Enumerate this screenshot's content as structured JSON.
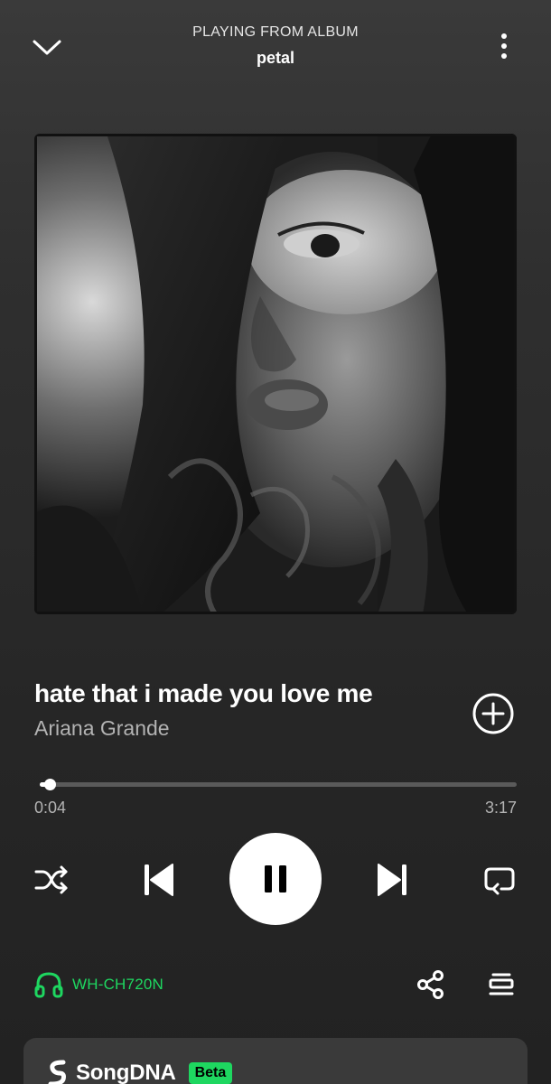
{
  "header": {
    "context_label": "PLAYING FROM ALBUM",
    "context_name": "petal",
    "collapse_icon": "chevron-down-icon",
    "more_icon": "more-vertical-icon"
  },
  "track": {
    "title": "hate that i made you love me",
    "artist": "Ariana Grande",
    "add_icon": "add-circle-icon"
  },
  "playback": {
    "elapsed": "0:04",
    "duration": "3:17",
    "progress_fraction": 0.02,
    "state": "playing"
  },
  "controls": {
    "shuffle_icon": "shuffle-icon",
    "previous_icon": "skip-previous-icon",
    "pause_icon": "pause-icon",
    "next_icon": "skip-next-icon",
    "repeat_icon": "repeat-icon"
  },
  "device": {
    "name": "WH-CH720N",
    "icon": "headphones-icon"
  },
  "actions": {
    "share_icon": "share-icon",
    "queue_icon": "queue-icon"
  },
  "card": {
    "name": "SongDNA",
    "badge": "Beta",
    "logo_icon": "songdna-logo-icon"
  },
  "colors": {
    "accent": "#1ed760",
    "background": "#2a2a2a",
    "text_secondary": "#b3b3b3",
    "card": "#3a3a3a"
  }
}
